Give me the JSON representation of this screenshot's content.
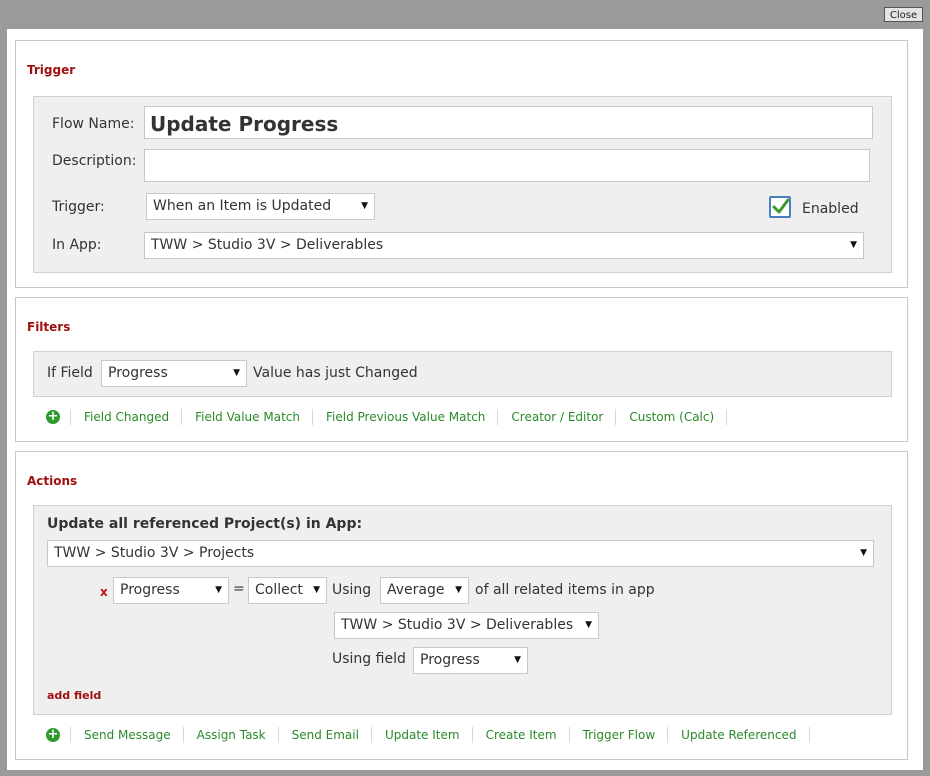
{
  "window": {
    "close_label": "Close"
  },
  "trigger": {
    "title": "Trigger",
    "flow_name_label": "Flow Name:",
    "flow_name_value": "Update Progress",
    "description_label": "Description:",
    "description_value": "",
    "trigger_label": "Trigger:",
    "trigger_value": "When an Item is Updated",
    "enabled_label": "Enabled",
    "enabled_checked": true,
    "in_app_label": "In App:",
    "in_app_value": "TWW > Studio 3V > Deliverables"
  },
  "filters": {
    "title": "Filters",
    "if_field_label": "If Field",
    "field_value": "Progress",
    "condition_text": "Value has just Changed",
    "links": [
      "Field Changed",
      "Field Value Match",
      "Field Previous Value Match",
      "Creator / Editor",
      "Custom (Calc)"
    ]
  },
  "actions": {
    "title": "Actions",
    "heading": "Update all referenced Project(s) in App:",
    "app_value": "TWW > Studio 3V > Projects",
    "remove_label": "x",
    "field_value": "Progress",
    "equals_label": "=",
    "mode_value": "Collect",
    "using_label": "Using",
    "aggregate_value": "Average",
    "related_label": "of all related items in app",
    "related_app_value": "TWW > Studio 3V > Deliverables",
    "using_field_label": "Using field",
    "using_field_value": "Progress",
    "add_field_label": "add field",
    "links": [
      "Send Message",
      "Assign Task",
      "Send Email",
      "Update Item",
      "Create Item",
      "Trigger Flow",
      "Update Referenced"
    ]
  },
  "colors": {
    "section_title": "#a01010",
    "link": "#2a8a2a",
    "add_icon": "#2e9a2e",
    "checkmark": "#3a9a2a"
  },
  "icons": {
    "add": "plus-circle-icon",
    "dropdown": "caret-down-icon",
    "check": "checkmark-icon"
  }
}
